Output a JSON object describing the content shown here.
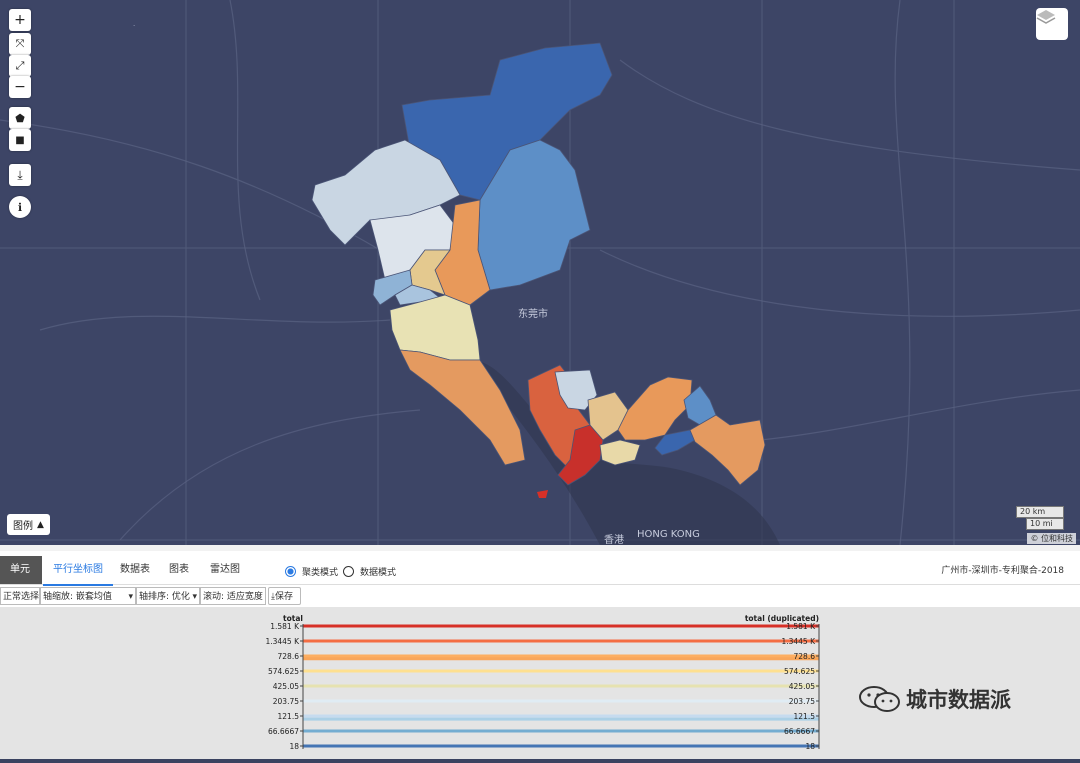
{
  "map": {
    "city_labels": [
      {
        "id": "dongguan",
        "text": "东莞市"
      },
      {
        "id": "hongkong",
        "text": "HONG KONG"
      },
      {
        "id": "xianggang",
        "text": "香港"
      }
    ],
    "legend_button": "图例",
    "scale_km": "20 km",
    "scale_mi": "10 mi",
    "attribution": "© 位和科技",
    "colors": {
      "bg": "#3d4566",
      "red": "#d73027",
      "orange": "#e89a5a",
      "cream": "#e8e2b4",
      "pale": "#c9d6e3",
      "light_blue": "#8fb3d6",
      "mid_blue": "#5d8fc7",
      "dark_blue": "#3a66ae"
    }
  },
  "panel": {
    "tabs": [
      {
        "label": "单元"
      },
      {
        "label": "平行坐标图"
      },
      {
        "label": "数据表"
      },
      {
        "label": "图表"
      },
      {
        "label": "雷达图"
      }
    ],
    "modes": [
      {
        "label": "聚类模式",
        "selected": true
      },
      {
        "label": "数据模式",
        "selected": false
      }
    ],
    "dataset_title": "广州市-深圳市-专利聚合-2018",
    "controls": {
      "select_mode": "正常选择",
      "axis_zoom": "轴缩放: 嵌套均值",
      "axis_order": "轴排序: 优化",
      "scroll": "滚动: 适应宽度",
      "save": "保存"
    }
  },
  "chart_data": {
    "type": "parallel_coordinates",
    "axes": [
      {
        "name": "total",
        "ticks": [
          "1.581 K",
          "1.3445 K",
          "728.6",
          "574.625",
          "425.05",
          "203.75",
          "121.5",
          "66.6667",
          "18"
        ]
      },
      {
        "name": "total (duplicated)",
        "ticks": [
          "1.581 K",
          "1.3445 K",
          "728.6",
          "574.625",
          "425.05",
          "203.75",
          "121.5",
          "66.6667",
          "18"
        ]
      }
    ],
    "lines": [
      {
        "value": 1581,
        "color": "#d73027"
      },
      {
        "value": 1344.5,
        "color": "#f46d43"
      },
      {
        "value": 728.6,
        "color": "#fdae61"
      },
      {
        "value": 700,
        "color": "#f9a65a"
      },
      {
        "value": 574.625,
        "color": "#fee090"
      },
      {
        "value": 425.05,
        "color": "#e6e2b0"
      },
      {
        "value": 203.75,
        "color": "#e0ecf4"
      },
      {
        "value": 121.5,
        "color": "#c6dbef"
      },
      {
        "value": 110,
        "color": "#abd0e6"
      },
      {
        "value": 66.6667,
        "color": "#74add1"
      },
      {
        "value": 18,
        "color": "#4575b4"
      }
    ]
  },
  "watermark": {
    "text": "城市数据派"
  }
}
